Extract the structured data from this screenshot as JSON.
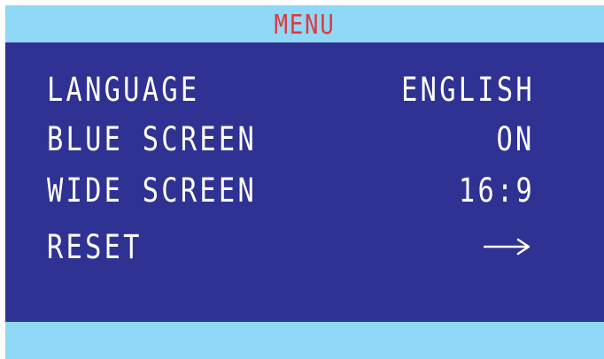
{
  "menu": {
    "title": "MENU",
    "items": [
      {
        "label": "LANGUAGE",
        "value": "ENGLISH"
      },
      {
        "label": "BLUE SCREEN",
        "value": "ON"
      },
      {
        "label": "WIDE SCREEN",
        "value": "16:9"
      },
      {
        "label": "RESET",
        "value": "",
        "value_icon": "right-arrow-icon"
      }
    ]
  },
  "colors": {
    "header_background": "#8fd8f6",
    "panel_background": "#2f3292",
    "title_text": "#e2373f",
    "item_text": "#ffffff"
  }
}
